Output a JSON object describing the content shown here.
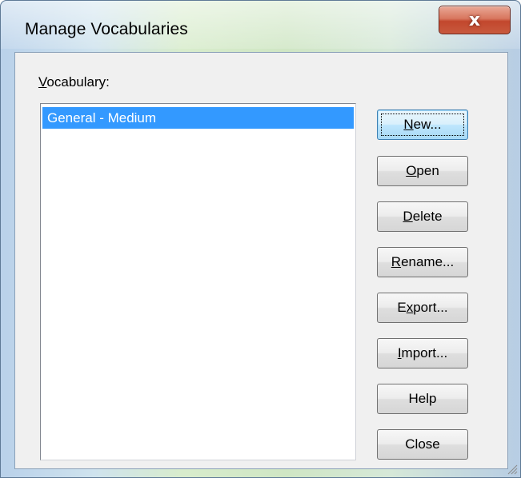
{
  "window": {
    "title": "Manage Vocabularies",
    "close_glyph": "x"
  },
  "vocabulary": {
    "label_mnemonic": "V",
    "label_rest": "ocabulary:",
    "items": [
      "General - Medium"
    ],
    "selected_index": 0
  },
  "buttons": {
    "new": {
      "mn": "N",
      "rest": "ew..."
    },
    "open": {
      "mn": "O",
      "rest": "pen"
    },
    "delete": {
      "mn": "D",
      "rest": "elete"
    },
    "rename": {
      "mn": "R",
      "rest": "ename..."
    },
    "export": {
      "pre": "E",
      "mn": "x",
      "rest": "port..."
    },
    "import": {
      "mn": "I",
      "rest": "mport..."
    },
    "help": {
      "label": "Help"
    },
    "close": {
      "label": "Close"
    }
  },
  "colors": {
    "selection": "#3399ff",
    "dialog_bg": "#f0f0f0",
    "close_button": "#c85a3e"
  },
  "icons": {
    "close": "close-icon",
    "resize": "resize-grip-icon"
  }
}
